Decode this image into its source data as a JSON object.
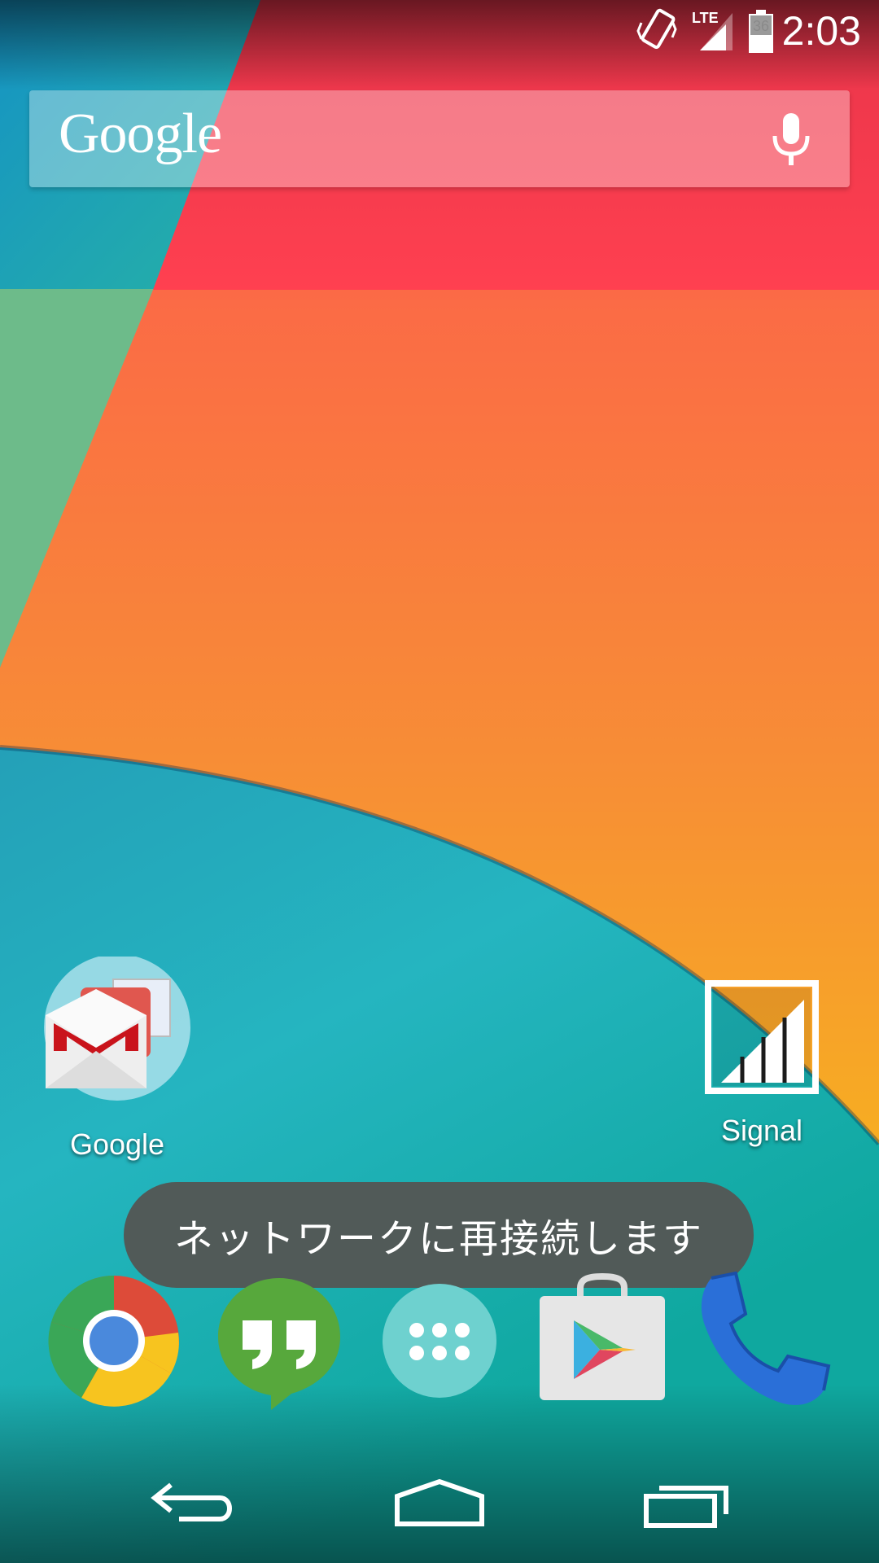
{
  "status_bar": {
    "time": "2:03",
    "network": "LTE",
    "battery_level": "36",
    "icons": [
      "vibrate-icon",
      "lte-signal-icon",
      "battery-icon"
    ]
  },
  "search": {
    "logo": "Google",
    "icons": [
      "mic-icon"
    ]
  },
  "desktop": [
    {
      "label": "Google",
      "icon": "google-folder-icon"
    },
    {
      "label": "Signal",
      "icon": "signal-app-icon"
    }
  ],
  "toast": {
    "message": "ネットワークに再接続します"
  },
  "dock": [
    "chrome-icon",
    "hangouts-icon",
    "app-drawer-icon",
    "play-store-icon",
    "phone-icon"
  ],
  "navigation": [
    "back-icon",
    "home-icon",
    "recents-icon"
  ],
  "colors": {
    "wallpaper_red": "#ff3d4d",
    "wallpaper_orange": "#f98c37",
    "wallpaper_teal": "#20a9b8",
    "wallpaper_blue": "#1c6f9c",
    "toast_bg": "#515a58"
  }
}
